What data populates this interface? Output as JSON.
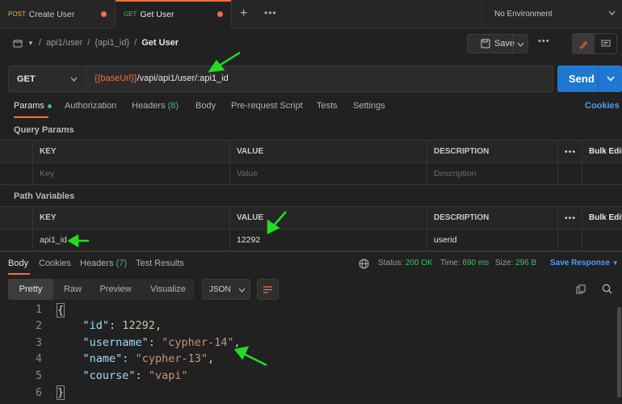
{
  "tabs": [
    {
      "method": "POST",
      "name": "Create User",
      "method_color": "#e8b53a"
    },
    {
      "method": "GET",
      "name": "Get User",
      "method_color": "#3fbf6f"
    }
  ],
  "environment": "No Environment",
  "breadcrumb": [
    "api1/user",
    "{api1_id}",
    "Get User"
  ],
  "toolbar": {
    "save_label": "Save"
  },
  "request": {
    "method": "GET",
    "url_var": "{{baseUrl}}",
    "url_path": "/vapi/api1/user/:api1_id",
    "send_label": "Send"
  },
  "request_tabs": [
    "Params",
    "Authorization",
    "Headers",
    "Body",
    "Pre-request Script",
    "Tests",
    "Settings"
  ],
  "headers_count": "(8)",
  "cookies_link": "Cookies",
  "query_params": {
    "title": "Query Params",
    "columns": [
      "KEY",
      "VALUE",
      "DESCRIPTION"
    ],
    "bulk_edit": "Bulk Edit",
    "placeholder": {
      "key": "Key",
      "value": "Value",
      "description": "Description"
    }
  },
  "path_variables": {
    "title": "Path Variables",
    "columns": [
      "KEY",
      "VALUE",
      "DESCRIPTION"
    ],
    "bulk_edit": "Bulk Edit",
    "rows": [
      {
        "key": "api1_id",
        "value": "12292",
        "description": "userid"
      }
    ]
  },
  "response_tabs": [
    "Body",
    "Cookies",
    "Headers",
    "Test Results"
  ],
  "response_headers_count": "(7)",
  "response_status": {
    "status_label": "Status:",
    "status": "200 OK",
    "time_label": "Time:",
    "time": "690 ms",
    "size_label": "Size:",
    "size": "296 B",
    "save_response": "Save Response"
  },
  "view_modes": [
    "Pretty",
    "Raw",
    "Preview",
    "Visualize"
  ],
  "format": "JSON",
  "body_lines": [
    {
      "n": "1",
      "text": "{"
    },
    {
      "n": "2",
      "key": "\"id\"",
      "sep": ": ",
      "num": "12292",
      "end": ","
    },
    {
      "n": "3",
      "key": "\"username\"",
      "sep": ": ",
      "str": "\"cypher-14\"",
      "end": ","
    },
    {
      "n": "4",
      "key": "\"name\"",
      "sep": ": ",
      "str": "\"cypher-13\"",
      "end": ","
    },
    {
      "n": "5",
      "key": "\"course\"",
      "sep": ": ",
      "str": "\"vapi\"",
      "end": ""
    },
    {
      "n": "6",
      "text": "}"
    }
  ],
  "colors": {
    "accent": "#ff6c37",
    "send": "#1f78d1",
    "annotation_arrow": "#22dd22"
  }
}
